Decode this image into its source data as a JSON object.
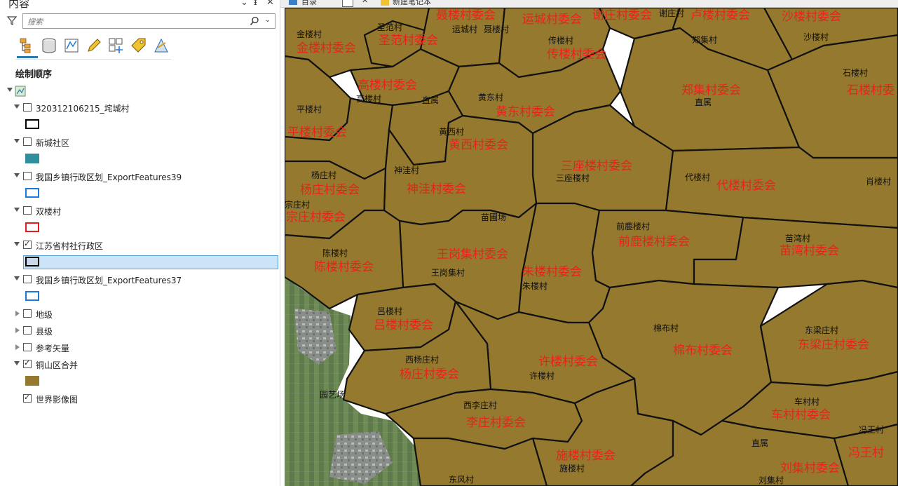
{
  "pane": {
    "title": "内容",
    "controls": {
      "dropdown": "⌄",
      "pin": "ᵻ",
      "close": "✕"
    },
    "search_placeholder": "搜索",
    "section_title": "绘制顺序",
    "toolbar": [
      "list-by-drawing-order-icon",
      "list-by-source-icon",
      "list-by-selection-icon",
      "list-by-editing-icon",
      "list-by-snapping-icon",
      "list-by-labeling-icon",
      "list-by-perspective-icon"
    ],
    "layers": [
      {
        "label": "320312106215_垞城村",
        "checked": false,
        "expanded": true,
        "swatch": {
          "fill": "#ffffff",
          "stroke": "#000000"
        }
      },
      {
        "label": "新城社区",
        "checked": false,
        "expanded": true,
        "swatch": {
          "fill": "#2f8f9d",
          "stroke": "#2f8f9d"
        }
      },
      {
        "label": "我国乡镇行政区划_ExportFeatures39",
        "checked": false,
        "expanded": true,
        "swatch": {
          "fill": "#ffffff",
          "stroke": "#1e7ad8"
        }
      },
      {
        "label": "双楼村",
        "checked": false,
        "expanded": true,
        "swatch": {
          "fill": "#ffffff",
          "stroke": "#e02020"
        }
      },
      {
        "label": "江苏省村社行政区",
        "checked": true,
        "expanded": true,
        "swatch": {
          "fill": "#c8d8e8",
          "stroke": "#000000"
        }
      },
      {
        "label": "我国乡镇行政区划_ExportFeatures37",
        "checked": false,
        "expanded": true,
        "swatch": {
          "fill": "#ffffff",
          "stroke": "#1e7ad8"
        }
      },
      {
        "label": "地级",
        "checked": false,
        "expanded": false
      },
      {
        "label": "县级",
        "checked": false,
        "expanded": false
      },
      {
        "label": "参考矢量",
        "checked": false,
        "expanded": false
      },
      {
        "label": "铜山区合并",
        "checked": true,
        "expanded": true,
        "swatch": {
          "fill": "#94792e",
          "stroke": "#94792e"
        }
      },
      {
        "label": "世界影像图",
        "checked": true,
        "expanded": null
      }
    ]
  },
  "tabs": [
    "目录",
    "新建笔记本"
  ],
  "map": {
    "fill": "#94792e",
    "red_labels": [
      {
        "t": "聂楼村委会"
      },
      {
        "t": "运城村委会"
      },
      {
        "t": "谢庄村委会"
      },
      {
        "t": "卢楼村委会"
      },
      {
        "t": "沙楼村委会"
      },
      {
        "t": "金楼村委会"
      },
      {
        "t": "圣范村委会"
      },
      {
        "t": "传楼村委会"
      },
      {
        "t": "高楼村委会"
      },
      {
        "t": "郑集村委会"
      },
      {
        "t": "石楼村委"
      },
      {
        "t": "黄东村委会"
      },
      {
        "t": "平楼村委会"
      },
      {
        "t": "黄西村委会"
      },
      {
        "t": "三座楼村委会"
      },
      {
        "t": "杨庄村委会"
      },
      {
        "t": "神洼村委会"
      },
      {
        "t": "代楼村委会"
      },
      {
        "t": "宗庄村委会"
      },
      {
        "t": "前鹿楼村委会"
      },
      {
        "t": "苗湾村委会"
      },
      {
        "t": "王岗集村委会"
      },
      {
        "t": "陈楼村委会"
      },
      {
        "t": "朱楼村委会"
      },
      {
        "t": "吕楼村委会"
      },
      {
        "t": "棉布村委会"
      },
      {
        "t": "东梁庄村委会"
      },
      {
        "t": "许楼村委会"
      },
      {
        "t": "杨庄村委会"
      },
      {
        "t": "李庄村委会"
      },
      {
        "t": "车村村委会"
      },
      {
        "t": "施楼村委会"
      },
      {
        "t": "刘集村委会"
      },
      {
        "t": "冯王村"
      }
    ],
    "black_labels": [
      {
        "t": "谢庄村"
      },
      {
        "t": "金楼村"
      },
      {
        "t": "圣范村"
      },
      {
        "t": "运城村"
      },
      {
        "t": "聂楼村"
      },
      {
        "t": "郑集村"
      },
      {
        "t": "沙楼村"
      },
      {
        "t": "传楼村"
      },
      {
        "t": "石楼村"
      },
      {
        "t": "高楼村"
      },
      {
        "t": "黄东村"
      },
      {
        "t": "直属"
      },
      {
        "t": "直属"
      },
      {
        "t": "平楼村"
      },
      {
        "t": "黄西村"
      },
      {
        "t": "神洼村"
      },
      {
        "t": "杨庄村"
      },
      {
        "t": "代楼村"
      },
      {
        "t": "三座楼村"
      },
      {
        "t": "肖楼村"
      },
      {
        "t": "宗庄村"
      },
      {
        "t": "苗圃场"
      },
      {
        "t": "前鹿楼村"
      },
      {
        "t": "苗湾村"
      },
      {
        "t": "陈楼村"
      },
      {
        "t": "王岗集村"
      },
      {
        "t": "朱楼村"
      },
      {
        "t": "吕楼村"
      },
      {
        "t": "棉布村"
      },
      {
        "t": "东梁庄村"
      },
      {
        "t": "西杨庄村"
      },
      {
        "t": "许楼村"
      },
      {
        "t": "园艺场"
      },
      {
        "t": "西李庄村"
      },
      {
        "t": "车村村"
      },
      {
        "t": "直属"
      },
      {
        "t": "冯王村"
      },
      {
        "t": "施楼村"
      },
      {
        "t": "东风村"
      },
      {
        "t": "刘集村"
      }
    ]
  }
}
